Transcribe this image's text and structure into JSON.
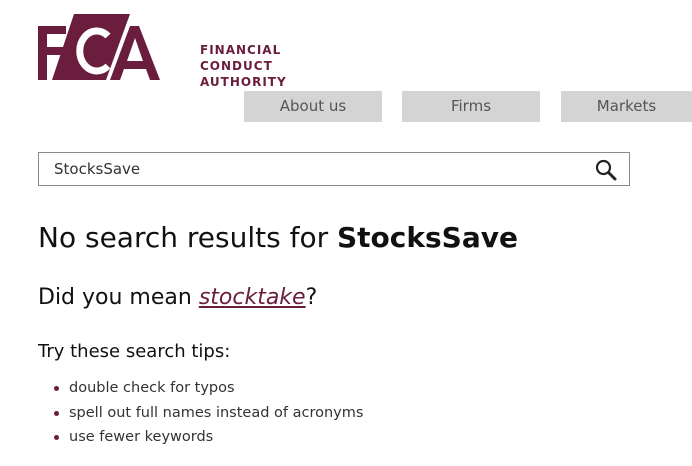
{
  "brand": {
    "logo_letters": "FCA",
    "name_lines": [
      "FINANCIAL",
      "CONDUCT",
      "AUTHORITY"
    ],
    "color": "#6a1d3c"
  },
  "nav": {
    "items": [
      {
        "label": "About us"
      },
      {
        "label": "Firms"
      },
      {
        "label": "Markets"
      }
    ]
  },
  "search": {
    "value": "StocksSave",
    "icon": "search-icon"
  },
  "results": {
    "heading_prefix": "No search results for ",
    "heading_term": "StocksSave",
    "suggest_prefix": "Did you mean ",
    "suggest_link": "stocktake",
    "suggest_suffix": "?",
    "tips_title": "Try these search tips:",
    "tips": [
      "double check for typos",
      "spell out full names instead of acronyms",
      "use fewer keywords"
    ]
  }
}
